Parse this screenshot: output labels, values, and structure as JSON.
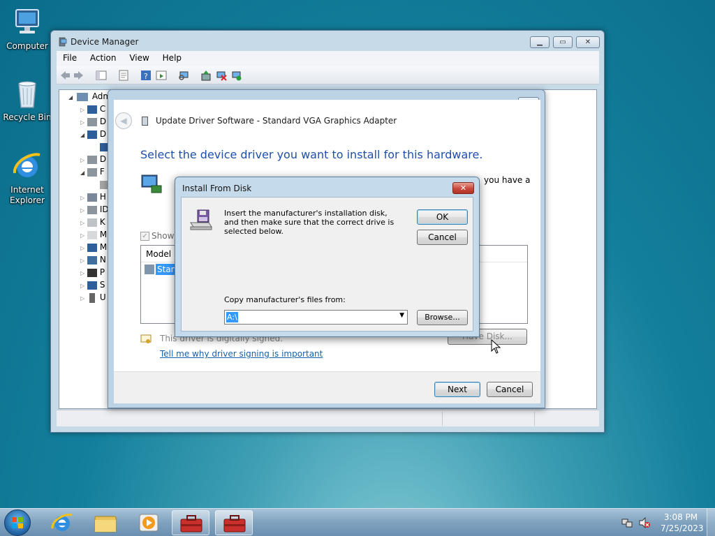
{
  "desktop": {
    "icons": [
      {
        "label": "Computer"
      },
      {
        "label": "Recycle Bin"
      },
      {
        "label": "Internet Explorer"
      }
    ]
  },
  "device_manager": {
    "title": "Device Manager",
    "menu": [
      "File",
      "Action",
      "View",
      "Help"
    ],
    "tree_root": "Adm",
    "tree_items": [
      "C",
      "D",
      "D",
      "",
      "D",
      "F",
      "",
      "H",
      "ID",
      "K",
      "M",
      "M",
      "N",
      "P",
      "S",
      "U"
    ]
  },
  "wizard": {
    "title": "Update Driver Software - Standard VGA Graphics Adapter",
    "heading": "Select the device driver you want to install for this hardware.",
    "intro_tail": "you have a",
    "show_compatible": "Show",
    "model_header": "Model",
    "model_item": "Stanc",
    "signed_text": "This driver is digitally signed.",
    "signing_link": "Tell me why driver signing is important",
    "have_disk": "Have Disk...",
    "next": "Next",
    "cancel": "Cancel"
  },
  "install_from_disk": {
    "title": "Install From Disk",
    "message": "Insert the manufacturer's installation disk, and then make sure that the correct drive is selected below.",
    "ok": "OK",
    "cancel": "Cancel",
    "copy_label": "Copy manufacturer's files from:",
    "path_value": "A:\\",
    "browse": "Browse..."
  },
  "taskbar": {
    "time": "3:08 PM",
    "date": "7/25/2023"
  },
  "colors": {
    "heading_blue": "#1e4fa8",
    "link_blue": "#1561ad",
    "selection": "#3399ff",
    "close_red": "#c9483b"
  }
}
